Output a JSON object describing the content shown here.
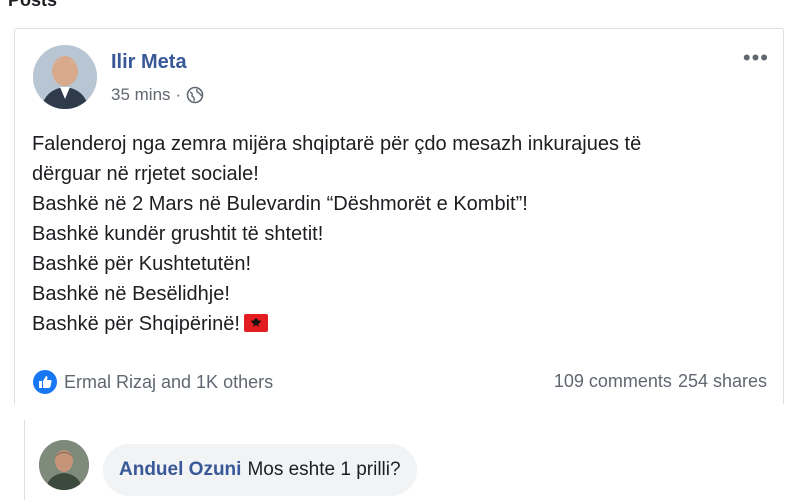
{
  "section": {
    "title": "Posts"
  },
  "post": {
    "author": "Ilir Meta",
    "time": "35 mins",
    "meta_separator": "·",
    "more_label": "•••",
    "body_lines": [
      "Falenderoj nga zemra mijëra shqiptarë për çdo mesazh inkurajues të",
      "dërguar në rrjetet sociale!",
      "Bashkë në 2 Mars në Bulevardin “Dëshmorët e Kombit”!",
      "Bashkë kundër grushtit të shtetit!",
      "Bashkë për Kushtetutën!",
      "Bashkë në Besëlidhje!",
      "Bashkë për Shqipërinë!"
    ],
    "reactions_text": "Ermal Rizaj and 1K others",
    "comments_count": "109 comments",
    "shares_count": "254 shares"
  },
  "comment": {
    "author": "Anduel Ozuni",
    "text": "Mos eshte 1 prilli?"
  },
  "icons": {
    "globe": "globe-icon",
    "like": "like-icon",
    "flag": "albania-flag-icon",
    "more": "more-options-icon"
  },
  "colors": {
    "link": "#385898",
    "like_blue": "#1877f2",
    "flag_red": "#e41e20",
    "bubble_bg": "#f2f3f5"
  }
}
